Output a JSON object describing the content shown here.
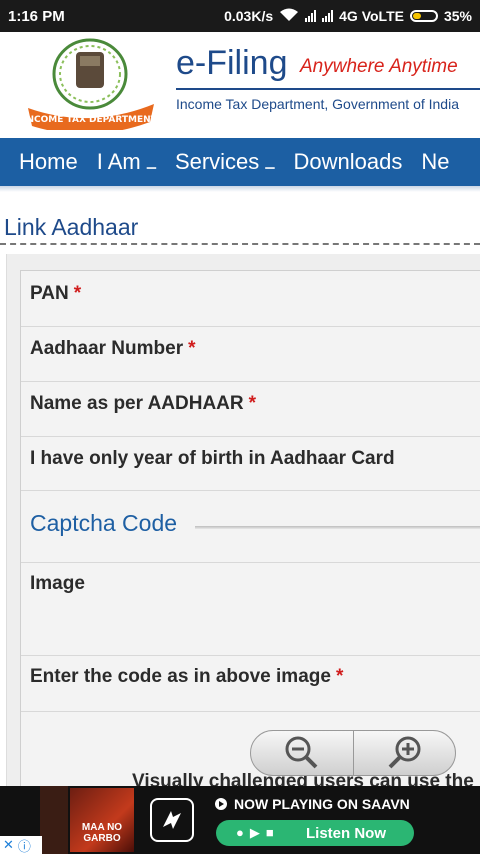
{
  "status_bar": {
    "time": "1:16 PM",
    "speed": "0.03K/s",
    "network": "4G VoLTE",
    "battery": "35%",
    "battery_level": 0.35
  },
  "header": {
    "title": "e-Filing",
    "tagline": "Anywhere Anytime",
    "subtitle": "Income Tax Department, Government of India",
    "emblem_text": "INCOME TAX DEPARTMENT"
  },
  "nav": {
    "items": [
      "Home",
      "I Am",
      "Services",
      "Downloads",
      "Ne"
    ]
  },
  "page": {
    "title": "Link Aadhaar"
  },
  "form": {
    "pan_label": "PAN",
    "aadhaar_label": "Aadhaar Number",
    "name_label": "Name as per AADHAAR",
    "yob_label": "I have only year of birth in Aadhaar Card",
    "captcha_heading": "Captcha Code",
    "image_label": "Image",
    "enter_code_label": "Enter the code as in above image",
    "required_mark": "*",
    "visually_challenged_text": "Visually challenged users can use the"
  },
  "ad": {
    "album_text": "MAA NO GARBO",
    "now_playing": "NOW PLAYING ON SAAVN",
    "listen_label": "Listen Now"
  },
  "colors": {
    "nav_bg": "#1c5fa3",
    "brand_blue": "#1e4a8a",
    "brand_red": "#d8231b",
    "required_red": "#d01c1c",
    "listen_green": "#2bb673"
  }
}
